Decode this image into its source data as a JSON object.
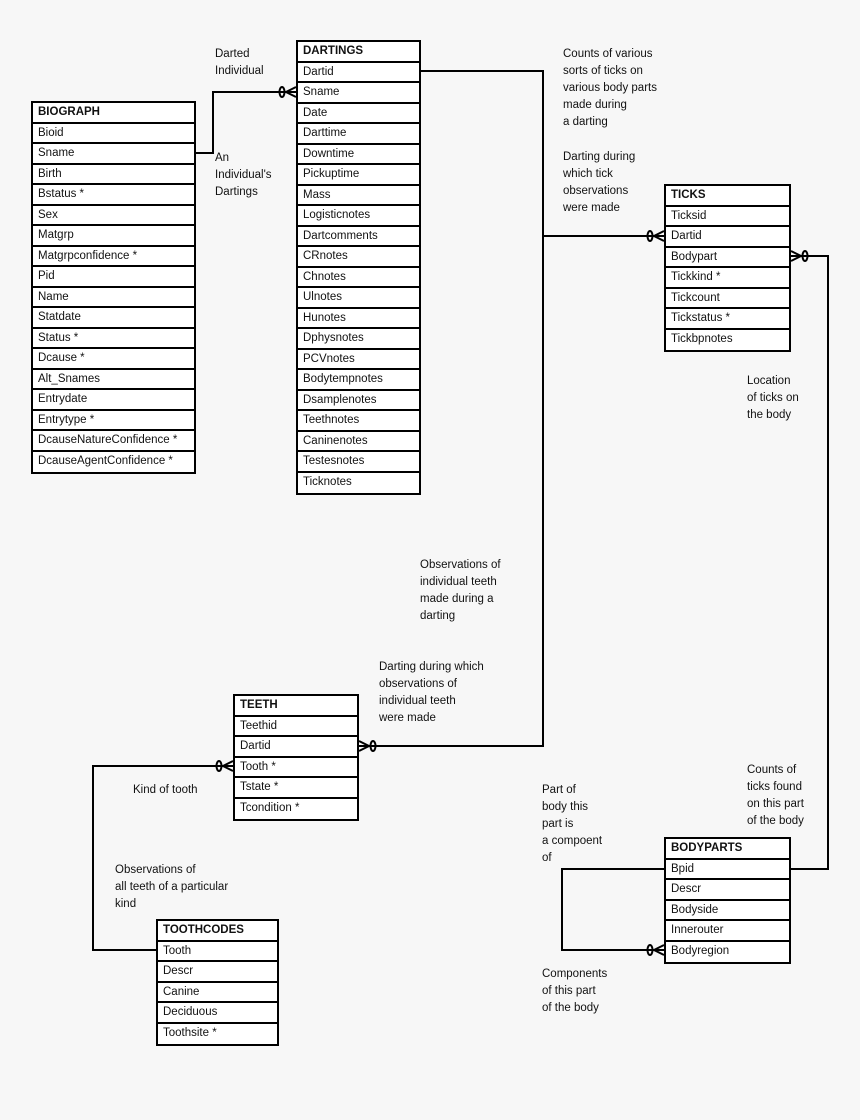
{
  "tables": {
    "biograph": {
      "title": "BIOGRAPH",
      "fields": [
        "Bioid",
        "Sname",
        "Birth",
        "Bstatus *",
        "Sex",
        "Matgrp",
        "Matgrpconfidence *",
        "Pid",
        "Name",
        "Statdate",
        "Status *",
        "Dcause *",
        "Alt_Snames",
        "Entrydate",
        "Entrytype *",
        "DcauseNatureConfidence *",
        "DcauseAgentConfidence *"
      ]
    },
    "dartings": {
      "title": "DARTINGS",
      "fields": [
        "Dartid",
        "Sname",
        "Date",
        "Darttime",
        "Downtime",
        "Pickuptime",
        "Mass",
        "Logisticnotes",
        "Dartcomments",
        "CRnotes",
        "Chnotes",
        "Ulnotes",
        "Hunotes",
        "Dphysnotes",
        "PCVnotes",
        "Bodytempnotes",
        "Dsamplenotes",
        "Teethnotes",
        "Caninenotes",
        "Testesnotes",
        "Ticknotes"
      ]
    },
    "ticks": {
      "title": "TICKS",
      "fields": [
        "Ticksid",
        "Dartid",
        "Bodypart",
        "Tickkind *",
        "Tickcount",
        "Tickstatus *",
        "Tickbpnotes"
      ]
    },
    "teeth": {
      "title": "TEETH",
      "fields": [
        "Teethid",
        "Dartid",
        "Tooth *",
        "Tstate *",
        "Tcondition *"
      ]
    },
    "toothcodes": {
      "title": "TOOTHCODES",
      "fields": [
        "Tooth",
        "Descr",
        "Canine",
        "Deciduous",
        "Toothsite *"
      ]
    },
    "bodyparts": {
      "title": "BODYPARTS",
      "fields": [
        "Bpid",
        "Descr",
        "Bodyside",
        "Innerouter",
        "Bodyregion"
      ]
    }
  },
  "labels": {
    "darted_individual": "Darted\nIndividual",
    "individuals_dartings": "An\nIndividual's\nDartings",
    "counts_ticks": "Counts of various\nsorts of ticks on\nvarious body parts\nmade during\na darting",
    "darting_tick_obs": "Darting during\nwhich tick\nobservations\nwere made",
    "location_ticks": "Location\nof ticks on\nthe body",
    "obs_teeth": "Observations of\nindividual teeth\nmade during a\ndarting",
    "darting_teeth": "Darting during which\nobservations of\nindividual teeth\nwere made",
    "kind_of_tooth": "Kind of tooth",
    "obs_all_teeth": "Observations of\nall teeth of a particular\nkind",
    "counts_ticks_part": "Counts of\nticks found\non this part\nof the body",
    "part_of_body": "Part of\nbody this\npart is\na compoent\nof",
    "components": "Components\nof this part\nof the body"
  }
}
